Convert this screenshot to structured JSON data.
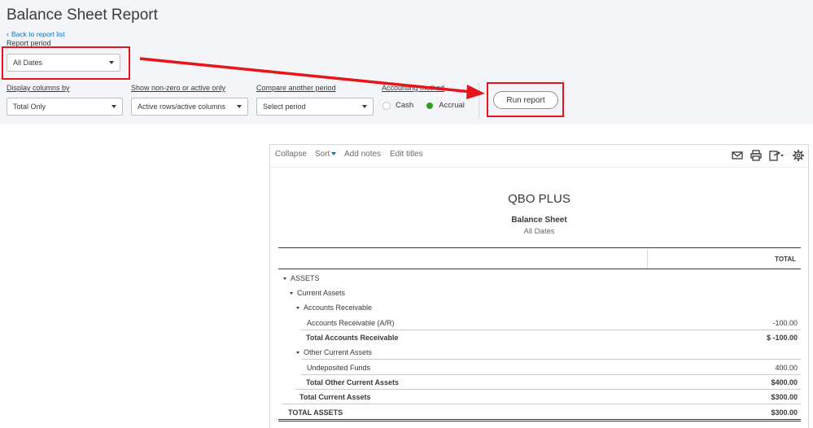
{
  "header": {
    "title": "Balance Sheet Report",
    "back_link": "Back to report list"
  },
  "filters": {
    "report_period": {
      "label": "Report period",
      "value": "All Dates"
    },
    "display_columns": {
      "label": "Display columns by",
      "value": "Total Only"
    },
    "show_non_zero": {
      "label": "Show non-zero or active only",
      "value": "Active rows/active columns"
    },
    "compare_period": {
      "label": "Compare another period",
      "value": "Select period"
    },
    "accounting_method": {
      "label": "Accounting method",
      "options": [
        {
          "label": "Cash",
          "selected": false
        },
        {
          "label": "Accrual",
          "selected": true
        }
      ]
    },
    "run_button": "Run report"
  },
  "toolbar": {
    "collapse": "Collapse",
    "sort": "Sort",
    "add_notes": "Add notes",
    "edit_titles": "Edit titles",
    "icons": [
      "email-icon",
      "print-icon",
      "export-icon",
      "settings-gear-icon"
    ]
  },
  "report": {
    "company": "QBO PLUS",
    "title": "Balance Sheet",
    "period": "All Dates",
    "column_header": "TOTAL",
    "rows": [
      {
        "label": "ASSETS",
        "amount": "",
        "bold": false,
        "collapsible": true
      },
      {
        "label": "Current Assets",
        "amount": "",
        "bold": false,
        "collapsible": true
      },
      {
        "label": "Accounts Receivable",
        "amount": "",
        "bold": false,
        "collapsible": true
      },
      {
        "label": "Accounts Receivable (A/R)",
        "amount": "-100.00",
        "bold": false,
        "collapsible": false
      },
      {
        "label": "Total Accounts Receivable",
        "amount": "$ -100.00",
        "bold": true,
        "collapsible": false
      },
      {
        "label": "Other Current Assets",
        "amount": "",
        "bold": false,
        "collapsible": true
      },
      {
        "label": "Undeposited Funds",
        "amount": "400.00",
        "bold": false,
        "collapsible": false
      },
      {
        "label": "Total Other Current Assets",
        "amount": "$400.00",
        "bold": true,
        "collapsible": false
      },
      {
        "label": "Total Current Assets",
        "amount": "$300.00",
        "bold": true,
        "collapsible": false
      },
      {
        "label": "TOTAL ASSETS",
        "amount": "$300.00",
        "bold": true,
        "collapsible": false
      }
    ]
  },
  "colors": {
    "highlight": "#e8141b",
    "link": "#0077c5",
    "accrual_radio": "#2ca01c",
    "panel_bg": "#f4f5f8"
  }
}
